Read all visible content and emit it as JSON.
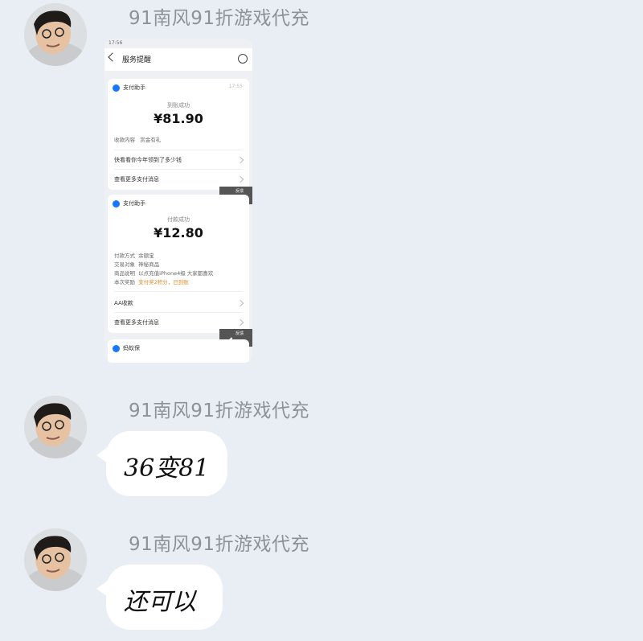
{
  "messages": [
    {
      "sender": "91南风91折游戏代充",
      "type": "image"
    },
    {
      "sender": "91南风91折游戏代充",
      "text": "36变81"
    },
    {
      "sender": "91南风91折游戏代充",
      "text": "还可以"
    }
  ],
  "screenshot": {
    "status_left": "17:56",
    "nav_title": "服务提醒",
    "cards": [
      {
        "header": "支付助手",
        "time": "17:55",
        "status": "到账成功",
        "amount": "¥81.90",
        "rows": [
          {
            "label": "收款内容",
            "value": "赏金有礼"
          }
        ],
        "links": [
          "快看看你今年领到了多少钱",
          "查看更多支付消息"
        ]
      },
      {
        "header": "支付助手",
        "status": "付款成功",
        "amount": "¥12.80",
        "rows": [
          {
            "label": "付款方式",
            "value": "余额宝"
          },
          {
            "label": "交易对象",
            "value": "神秘商品"
          },
          {
            "label": "商品说明",
            "value": "以点充值iPhone4级 大家都喜欢"
          },
          {
            "label": "本次奖励",
            "value": "支付奖2积分，已到账"
          }
        ],
        "links": [
          "AA收款",
          "查看更多支付消息"
        ]
      },
      {
        "header": "蚂蚁保"
      }
    ],
    "feedback_label": "反馈"
  }
}
